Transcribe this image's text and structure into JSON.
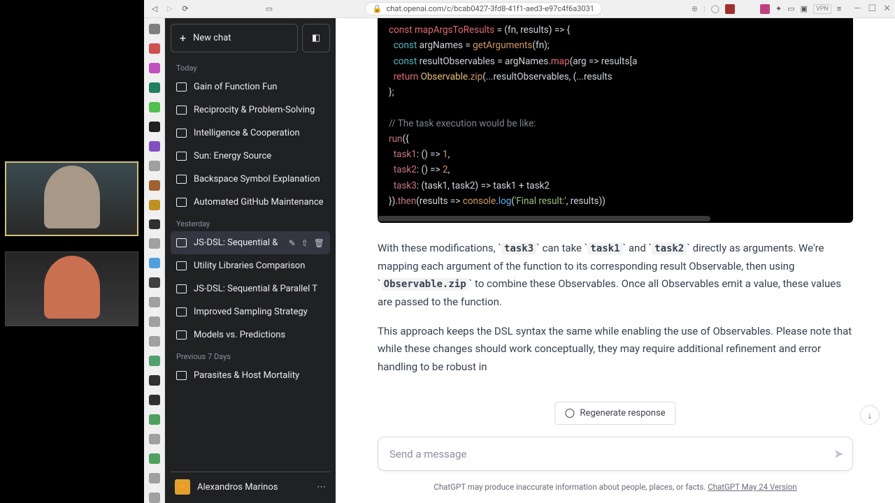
{
  "browser": {
    "url_lock": "🔒",
    "url": "chat.openai.com/c/bcab0427-3fd8-41f1-aed3-e97c4f6a3031",
    "vpn": "VPN"
  },
  "rail_colors": [
    "#808080",
    "#d05050",
    "#c050c0",
    "#208060",
    "#50c050",
    "#202020",
    "#8050c0",
    "#a0a0a0",
    "#a06030",
    "#c09020",
    "#303030",
    "#a0a0a0",
    "#50a0e0",
    "#404040",
    "#a0a0a0",
    "#a0a0a0",
    "#a0a0a0",
    "#50a070",
    "#303030",
    "#303030",
    "#50a060",
    "#a0a0a0",
    "#50a060",
    "#a0a0a0",
    "#a0a0a0"
  ],
  "sidebar": {
    "new_chat": "New chat",
    "sections": {
      "today": "Today",
      "yesterday": "Yesterday",
      "prev7": "Previous 7 Days"
    },
    "today_items": [
      "Gain of Function Fun",
      "Reciprocity & Problem-Solving",
      "Intelligence & Cooperation",
      "Sun: Energy Source",
      "Backspace Symbol Explanation",
      "Automated GitHub Maintenance"
    ],
    "yesterday_items": [
      "JS-DSL: Sequential &",
      "Utility Libraries Comparison",
      "JS-DSL: Sequential & Parallel T",
      "Improved Sampling Strategy",
      "Models vs. Predictions"
    ],
    "prev7_items": [
      "Parasites & Host Mortality"
    ],
    "active_index": 0,
    "user": "Alexandros Marinos",
    "avatar_emoji": "🔆"
  },
  "code": {
    "l0a": "const",
    "l0b": "mapArgsToResults",
    "l0c": " = (fn, results) => {",
    "l1a": "const",
    "l1b": " argNames = ",
    "l1c": "getArguments",
    "l1d": "(fn);",
    "l2a": "const",
    "l2b": " resultObservables = argNames.",
    "l2c": "map",
    "l2d": "(arg => results[a",
    "l3a": "return",
    "l3b": "Observable",
    "l3c": ".",
    "l3d": "zip",
    "l3e": "(...resultObservables, (...results",
    "l4": "};",
    "l5": "// The task execution would be like:",
    "l6a": "run",
    "l6b": "({",
    "l7a": "task1",
    "l7b": ": () => ",
    "l7c": "1",
    "l7d": ",",
    "l8a": "task2",
    "l8b": ": () => ",
    "l8c": "2",
    "l8d": ",",
    "l9a": "task3",
    "l9b": ": (task1, task2) => task1 + task2",
    "l10a": "}).",
    "l10b": "then",
    "l10c": "(results => ",
    "l10d": "console",
    "l10e": ".",
    "l10f": "log",
    "l10g": "(",
    "l10h": "'Final result:'",
    "l10i": ", results))"
  },
  "text": {
    "p1_a": "With these modifications, ",
    "p1_code1": "task3",
    "p1_b": " can take ",
    "p1_code2": "task1",
    "p1_c": " and ",
    "p1_code3": "task2",
    "p1_d": " directly as arguments. We're mapping each argument of the function to its corresponding result Observable, then using ",
    "p1_code4": "Observable.zip",
    "p1_e": " to combine these Observables. Once all Observables emit a value, these values are passed to the function.",
    "p2": "This approach keeps the DSL syntax the same while enabling the use of Observables. Please note that while these changes should work conceptually, they may require additional refinement and error handling to be robust in"
  },
  "regen": "Regenerate response",
  "input_placeholder": "Send a message",
  "disclaimer_a": "ChatGPT may produce inaccurate information about people, places, or facts. ",
  "disclaimer_link": "ChatGPT May 24 Version"
}
